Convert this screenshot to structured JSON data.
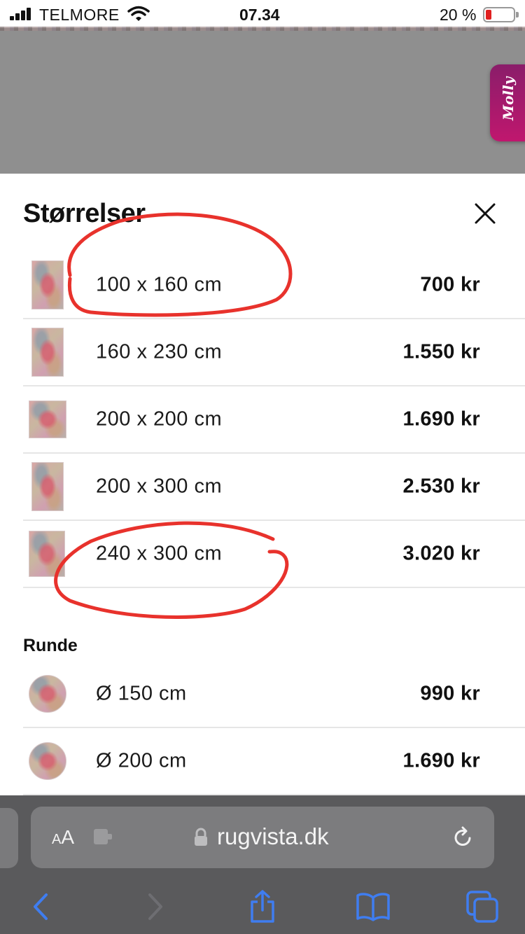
{
  "status_bar": {
    "carrier": "TELMORE",
    "time": "07.34",
    "battery_percent": "20 %",
    "battery_level": 0.2,
    "battery_color": "#e02020"
  },
  "molly_tab": {
    "label": "Molly"
  },
  "sheet": {
    "title": "Størrelser",
    "close_icon": "close-icon",
    "rectangular_sizes": [
      {
        "size": "100 x 160 cm",
        "price": "700 kr"
      },
      {
        "size": "160 x 230 cm",
        "price": "1.550 kr"
      },
      {
        "size": "200 x 200 cm",
        "price": "1.690 kr"
      },
      {
        "size": "200 x 300 cm",
        "price": "2.530 kr"
      },
      {
        "size": "240 x 300 cm",
        "price": "3.020 kr"
      }
    ],
    "round_section_title": "Runde",
    "round_sizes": [
      {
        "size": "Ø 150 cm",
        "price": "990 kr"
      },
      {
        "size": "Ø 200 cm",
        "price": "1.690 kr"
      }
    ],
    "annotation_color": "#e8322c"
  },
  "safari": {
    "text_size_label": "AA",
    "domain": "rugvista.dk",
    "accent": "#3f7df0"
  }
}
